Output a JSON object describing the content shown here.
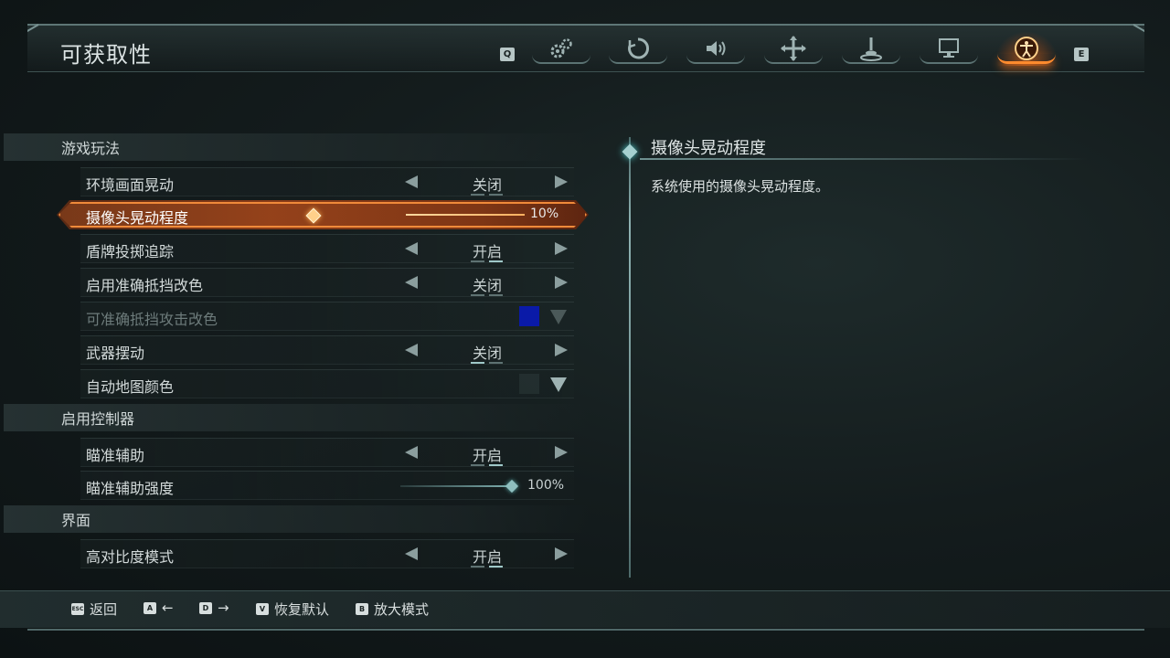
{
  "header": {
    "title": "可获取性",
    "prev_key": "Q",
    "next_key": "E",
    "tabs": [
      {
        "icon": "gears-icon",
        "active": false
      },
      {
        "icon": "refresh-swirl-icon",
        "active": false
      },
      {
        "icon": "speaker-icon",
        "active": false
      },
      {
        "icon": "move-cross-icon",
        "active": false
      },
      {
        "icon": "joystick-icon",
        "active": false
      },
      {
        "icon": "monitor-icon",
        "active": false
      },
      {
        "icon": "accessibility-icon",
        "active": true
      }
    ]
  },
  "sections": {
    "gameplay": "游戏玩法",
    "controller": "启用控制器",
    "interface": "界面"
  },
  "rows": {
    "env_shake": {
      "label": "环境画面晃动",
      "value": "关闭"
    },
    "camera_shake": {
      "label": "摄像头晃动程度",
      "value_text": "10%",
      "value": 0.1
    },
    "shield_tracking": {
      "label": "盾牌投掷追踪",
      "value": "开启"
    },
    "parry_color_enable": {
      "label": "启用准确抵挡改色",
      "value": "关闭"
    },
    "parry_color": {
      "label": "可准确抵挡攻击改色",
      "swatch_color": "#0a1aa8"
    },
    "weapon_sway": {
      "label": "武器摆动",
      "value": "关闭"
    },
    "automap_color": {
      "label": "自动地图颜色"
    },
    "aim_assist": {
      "label": "瞄准辅助",
      "value": "开启"
    },
    "aim_assist_strength": {
      "label": "瞄准辅助强度",
      "value_text": "100%",
      "value": 1.0
    },
    "high_contrast": {
      "label": "高对比度模式",
      "value": "开启"
    }
  },
  "description": {
    "title": "摄像头晃动程度",
    "text": "系统使用的摄像头晃动程度。"
  },
  "footer": {
    "back": {
      "key": "ESC",
      "label": "返回"
    },
    "left": {
      "key": "A",
      "label": "←"
    },
    "right": {
      "key": "D",
      "label": "→"
    },
    "reset": {
      "key": "V",
      "label": "恢复默认"
    },
    "zoom": {
      "key": "B",
      "label": "放大模式"
    }
  },
  "colors": {
    "accent_orange": "#f08a3a",
    "teal": "#8fb3b3"
  }
}
